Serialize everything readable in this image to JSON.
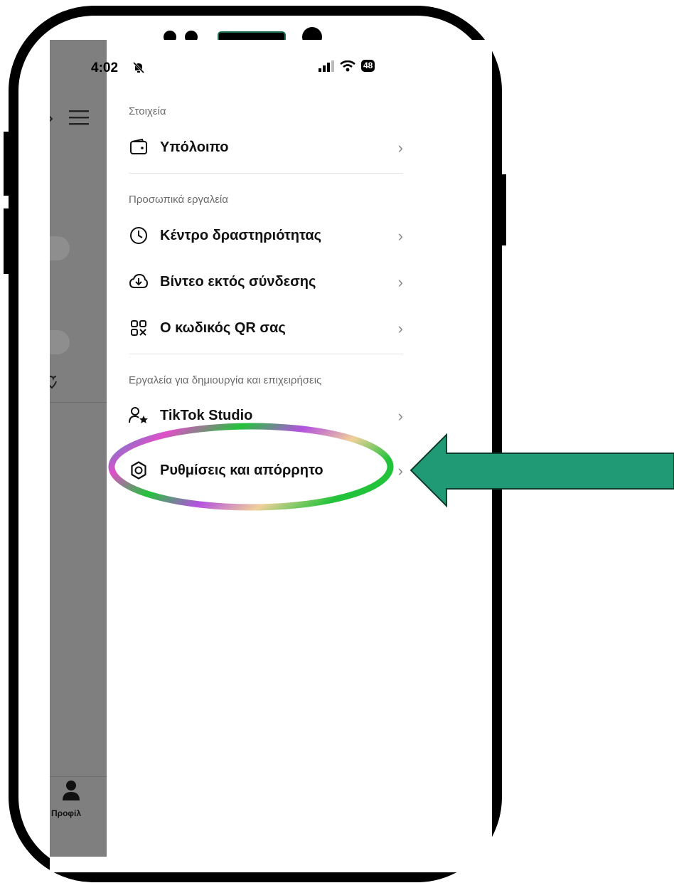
{
  "status_bar": {
    "time": "4:02",
    "battery": "48"
  },
  "background_nav": {
    "profile_label": "Προφίλ"
  },
  "menu": {
    "sections": [
      {
        "title": "Στοιχεία"
      },
      {
        "title": "Προσωπικά εργαλεία"
      },
      {
        "title": "Εργαλεία για δημιουργία και επιχειρήσεις"
      }
    ],
    "items": [
      {
        "label": "Υπόλοιπο",
        "icon": "wallet-icon"
      },
      {
        "label": "Κέντρο δραστηριότητας",
        "icon": "clock-icon"
      },
      {
        "label": "Βίντεο εκτός σύνδεσης",
        "icon": "cloud-download-icon"
      },
      {
        "label": "Ο κωδικός QR σας",
        "icon": "qr-code-icon"
      },
      {
        "label": "TikTok Studio",
        "icon": "person-star-icon"
      },
      {
        "label": "Ρυθμίσεις και απόρρητο",
        "icon": "gear-icon"
      }
    ]
  },
  "annotation": {
    "arrow_color": "#1f9a74",
    "highlight_target": "Ρυθμίσεις και απόρρητο"
  }
}
